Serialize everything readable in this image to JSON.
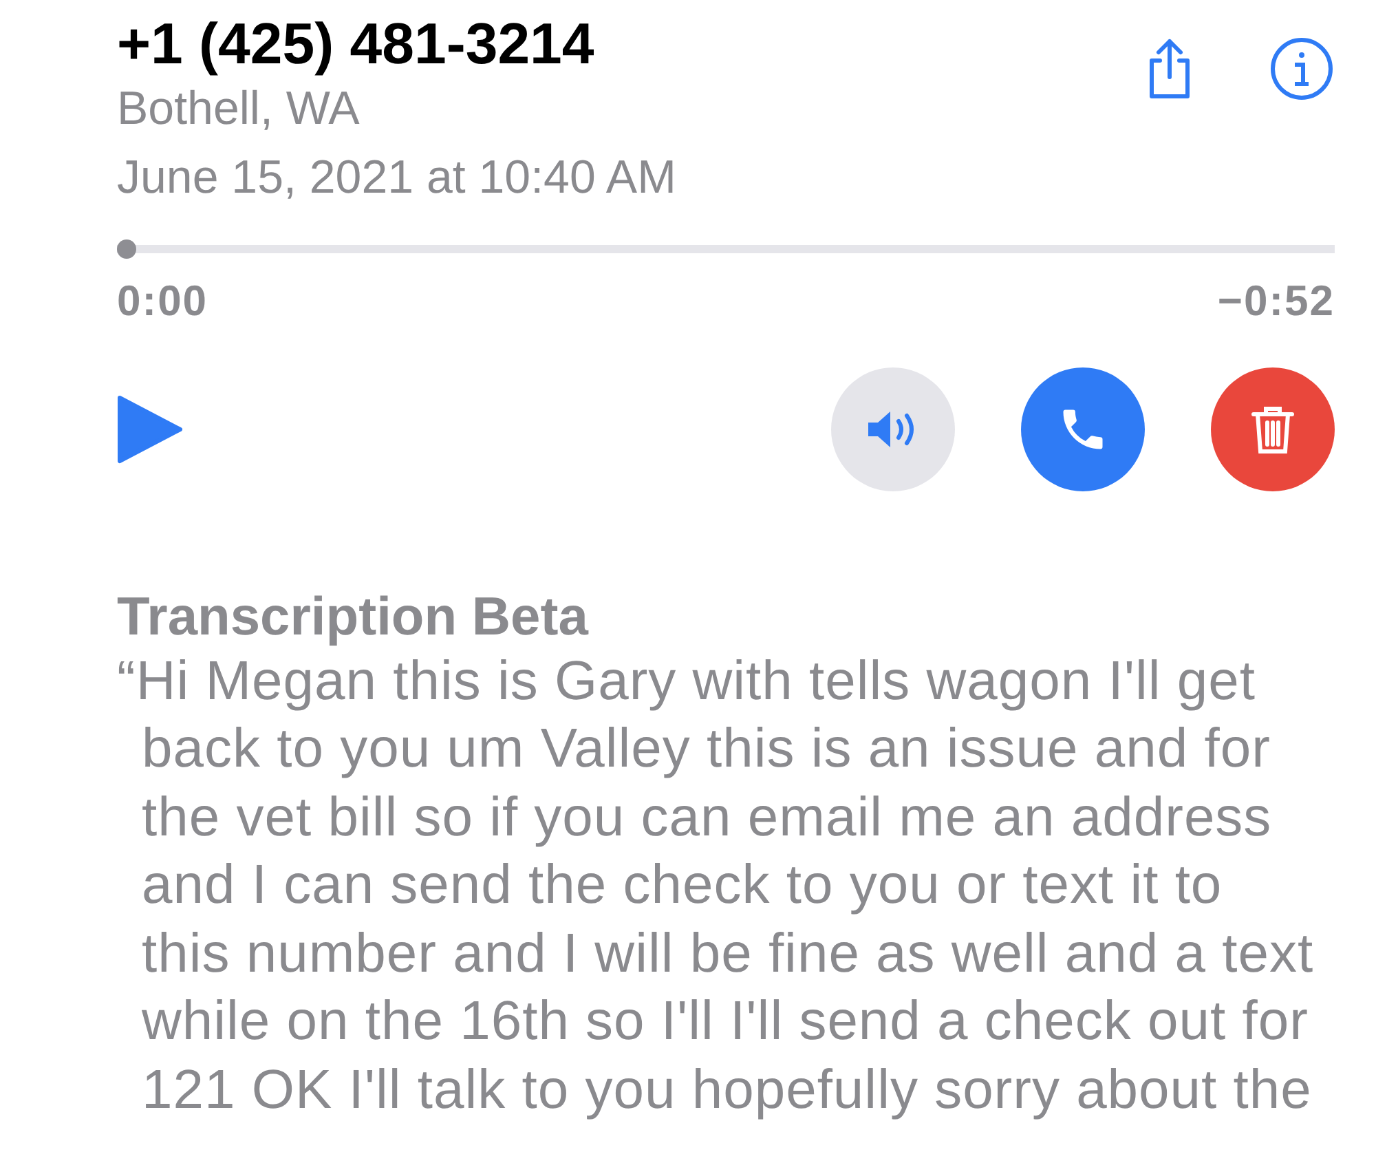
{
  "caller": {
    "number": "+1 (425) 481-3214",
    "location": "Bothell, WA",
    "date": "June 15, 2021 at 10:40 AM"
  },
  "toolbar": [
    {
      "kind": "share"
    },
    {
      "kind": "info"
    }
  ],
  "playback": {
    "level": 0.0,
    "elapsed": "0:00",
    "remaining": "−0:52"
  },
  "controls": [
    {
      "kind": "play"
    },
    {
      "kind": "speaker"
    },
    {
      "kind": "call"
    },
    {
      "kind": "delete"
    }
  ],
  "transcription": {
    "title": "Transcription Beta",
    "lines": [
      "“Hi Megan this is Gary with tells wagon I'll get",
      "back to you um Valley this is an issue and for",
      "the vet bill so if you can email me an address",
      "and I can send the check to you or text it to",
      "this number and I will be fine as well and a text",
      "while on the 16th so I'll I'll send a check out for",
      "121 OK I'll talk to you hopefully sorry about the"
    ]
  }
}
